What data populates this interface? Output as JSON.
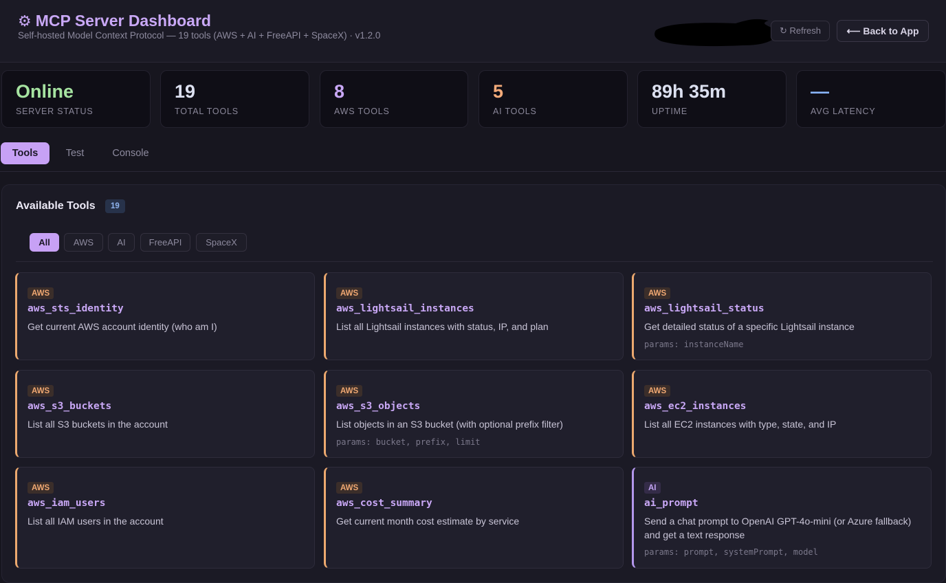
{
  "header": {
    "title": "MCP Server Dashboard",
    "subtitle": "Self-hosted Model Context Protocol — 19 tools (AWS + AI + FreeAPI + SpaceX) · v1.2.0",
    "refresh_label": "↻ Refresh",
    "back_label": "⟵ Back to App"
  },
  "stats": [
    {
      "value": "Online",
      "label": "SERVER STATUS",
      "color": "#a6e3a1"
    },
    {
      "value": "19",
      "label": "TOTAL TOOLS",
      "color": "#dce0f0"
    },
    {
      "value": "8",
      "label": "AWS TOOLS",
      "color": "#c9a8f6"
    },
    {
      "value": "5",
      "label": "AI TOOLS",
      "color": "#f4ab7a"
    },
    {
      "value": "89h 35m",
      "label": "UPTIME",
      "color": "#dce0f0"
    },
    {
      "value": "—",
      "label": "AVG LATENCY",
      "color": "#89b4fa"
    }
  ],
  "tabs": [
    {
      "label": "Tools",
      "active": true
    },
    {
      "label": "Test",
      "active": false
    },
    {
      "label": "Console",
      "active": false
    }
  ],
  "tools_panel": {
    "title": "Available Tools",
    "count": "19",
    "filters": [
      "All",
      "AWS",
      "AI",
      "FreeAPI",
      "SpaceX"
    ],
    "active_filter": "All"
  },
  "tools": [
    {
      "category": "AWS",
      "name": "aws_sts_identity",
      "description": "Get current AWS account identity (who am I)",
      "params": ""
    },
    {
      "category": "AWS",
      "name": "aws_lightsail_instances",
      "description": "List all Lightsail instances with status, IP, and plan",
      "params": ""
    },
    {
      "category": "AWS",
      "name": "aws_lightsail_status",
      "description": "Get detailed status of a specific Lightsail instance",
      "params": "params: instanceName"
    },
    {
      "category": "AWS",
      "name": "aws_s3_buckets",
      "description": "List all S3 buckets in the account",
      "params": ""
    },
    {
      "category": "AWS",
      "name": "aws_s3_objects",
      "description": "List objects in an S3 bucket (with optional prefix filter)",
      "params": "params: bucket, prefix, limit"
    },
    {
      "category": "AWS",
      "name": "aws_ec2_instances",
      "description": "List all EC2 instances with type, state, and IP",
      "params": ""
    },
    {
      "category": "AWS",
      "name": "aws_iam_users",
      "description": "List all IAM users in the account",
      "params": ""
    },
    {
      "category": "AWS",
      "name": "aws_cost_summary",
      "description": "Get current month cost estimate by service",
      "params": ""
    },
    {
      "category": "AI",
      "name": "ai_prompt",
      "description": "Send a chat prompt to OpenAI GPT-4o-mini (or Azure fallback) and get a text response",
      "params": "params: prompt, systemPrompt, model"
    }
  ],
  "colors": {
    "accent": "#c7a1f5",
    "aws": "#eda96f",
    "ai": "#b497ec"
  }
}
